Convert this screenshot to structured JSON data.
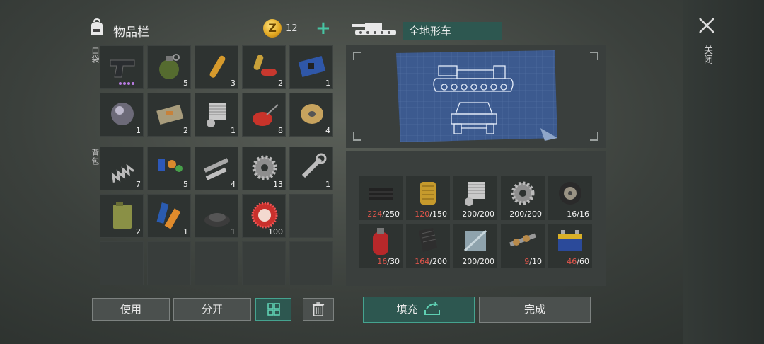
{
  "inventory": {
    "title": "物品栏",
    "coins": "12",
    "coin_symbol": "Z",
    "pocket_label": "口袋",
    "backpack_label": "背包",
    "pocket_slots": [
      {
        "icon": "pistol-icon",
        "count": ""
      },
      {
        "icon": "grenade-icon",
        "count": "5"
      },
      {
        "icon": "ampoule-icon",
        "count": "3"
      },
      {
        "icon": "pill-capsule-icon",
        "count": "2"
      },
      {
        "icon": "circuit-board-icon",
        "count": "1"
      },
      {
        "icon": "lens-icon",
        "count": "1"
      },
      {
        "icon": "c4-explosive-icon",
        "count": "2"
      },
      {
        "icon": "engine-cylinder-icon",
        "count": "1"
      },
      {
        "icon": "oil-can-icon",
        "count": "8"
      },
      {
        "icon": "wire-spool-icon",
        "count": "4"
      }
    ],
    "backpack_slots": [
      {
        "icon": "spring-icon",
        "count": "7"
      },
      {
        "icon": "capacitors-icon",
        "count": "5"
      },
      {
        "icon": "metal-pipes-icon",
        "count": "4"
      },
      {
        "icon": "gear-icon",
        "count": "13"
      },
      {
        "icon": "wrench-icon",
        "count": "1"
      },
      {
        "icon": "jerry-can-icon",
        "count": "2"
      },
      {
        "icon": "batteries-icon",
        "count": "1"
      },
      {
        "icon": "gunpowder-pile-icon",
        "count": "1"
      },
      {
        "icon": "bottle-cap-icon",
        "count": "100"
      },
      {
        "icon": "",
        "count": ""
      },
      {
        "icon": "",
        "count": ""
      },
      {
        "icon": "",
        "count": ""
      },
      {
        "icon": "",
        "count": ""
      },
      {
        "icon": "",
        "count": ""
      },
      {
        "icon": "",
        "count": ""
      }
    ],
    "buttons": {
      "use": "使用",
      "split": "分开"
    }
  },
  "vehicle": {
    "name": "全地形车",
    "materials": [
      {
        "icon": "rubber-sheet-icon",
        "have": "224",
        "need": "/250",
        "low": true
      },
      {
        "icon": "air-filter-icon",
        "have": "120",
        "need": "/150",
        "low": true
      },
      {
        "icon": "engine-cylinder-icon",
        "have": "200",
        "need": "/200",
        "low": false
      },
      {
        "icon": "gear-icon",
        "have": "200",
        "need": "/200",
        "low": false
      },
      {
        "icon": "tire-icon",
        "have": "16",
        "need": "/16",
        "low": false
      },
      {
        "icon": "gas-cylinder-icon",
        "have": "16",
        "need": "/30",
        "low": true
      },
      {
        "icon": "car-seat-icon",
        "have": "164",
        "need": "/200",
        "low": true
      },
      {
        "icon": "metal-plate-icon",
        "have": "200",
        "need": "/200",
        "low": false
      },
      {
        "icon": "camshaft-icon",
        "have": "9",
        "need": "/10",
        "low": true
      },
      {
        "icon": "car-battery-icon",
        "have": "46",
        "need": "/60",
        "low": true
      }
    ],
    "buttons": {
      "fill": "填充",
      "done": "完成"
    }
  },
  "close": {
    "label": "关闭"
  },
  "colors": {
    "accent": "#45a38f",
    "low": "#e0554b",
    "panel": "#3a3f3d"
  }
}
